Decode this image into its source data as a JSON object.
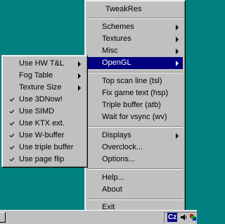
{
  "main_menu": {
    "title": "TweakRes",
    "items": [
      {
        "label": "Schemes",
        "submenu": true
      },
      {
        "label": "Textures",
        "submenu": true
      },
      {
        "label": "Misc",
        "submenu": true
      },
      {
        "label": "OpenGL",
        "submenu": true,
        "selected": true
      },
      {
        "label": "Top scan line (tsl)"
      },
      {
        "label": "Fix game text (hsp)"
      },
      {
        "label": "Triple buffer (atb)"
      },
      {
        "label": "Wait for vsync (wv)"
      },
      {
        "label": "Displays",
        "submenu": true
      },
      {
        "label": "Overclock..."
      },
      {
        "label": "Options..."
      },
      {
        "label": "Help..."
      },
      {
        "label": "About"
      },
      {
        "label": "Exit"
      }
    ]
  },
  "opengl_submenu": {
    "items": [
      {
        "label": "Use HW T&L",
        "submenu": true
      },
      {
        "label": "Fog Table",
        "submenu": true
      },
      {
        "label": "Texture Size",
        "submenu": true
      },
      {
        "label": "Use 3DNow!",
        "checked": true
      },
      {
        "label": "Use SIMD",
        "checked": true
      },
      {
        "label": "Use KTX ext.",
        "checked": true
      },
      {
        "label": "Use W-buffer",
        "checked": true
      },
      {
        "label": "Use triple buffer",
        "checked": true
      },
      {
        "label": "Use page flip",
        "checked": true
      }
    ]
  },
  "taskbar": {
    "language_indicator": "Cz",
    "tray_icons": [
      "volume-icon",
      "tweakres-tray-icon"
    ]
  }
}
